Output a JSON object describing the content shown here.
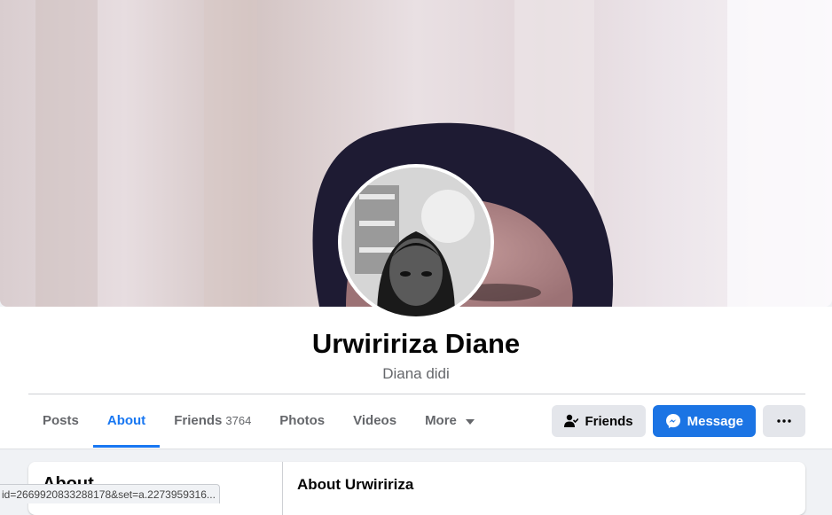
{
  "profile": {
    "name": "Urwiririza Diane",
    "nickname": "Diana didi"
  },
  "tabs": [
    {
      "label": "Posts",
      "count": ""
    },
    {
      "label": "About",
      "count": ""
    },
    {
      "label": "Friends",
      "count": "3764"
    },
    {
      "label": "Photos",
      "count": ""
    },
    {
      "label": "Videos",
      "count": ""
    },
    {
      "label": "More",
      "count": ""
    }
  ],
  "active_tab": "About",
  "actions": {
    "friends_label": "Friends",
    "message_label": "Message",
    "more_icon": "ellipsis-icon"
  },
  "about": {
    "nav_title": "About",
    "section_title": "About Urwiririza"
  },
  "status_bar": {
    "url": "id=2669920833288178&set=a.2273959316..."
  },
  "colors": {
    "accent": "#1877f2",
    "message_button": "#1b74e4",
    "secondary_button": "#e4e6eb",
    "page_background": "#f0f2f5",
    "muted_text": "#65676b"
  }
}
